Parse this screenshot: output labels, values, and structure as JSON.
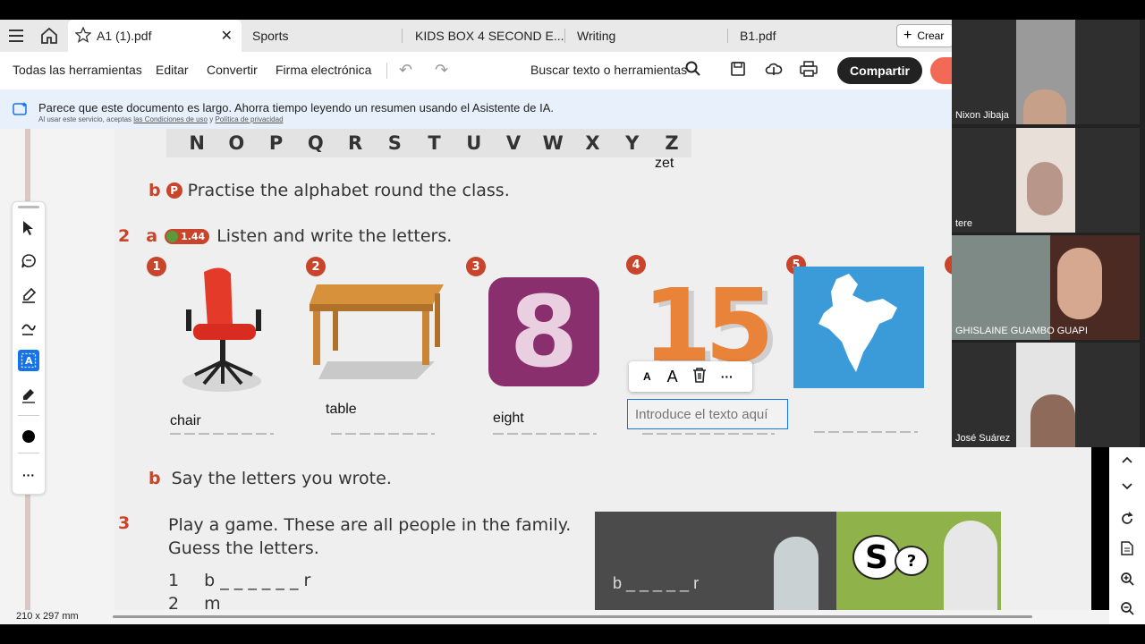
{
  "tabs": [
    {
      "label": "A1 (1).pdf",
      "active": true
    },
    {
      "label": "Sports"
    },
    {
      "label": "KIDS BOX 4 SECOND E..."
    },
    {
      "label": "Writing"
    },
    {
      "label": "B1.pdf"
    }
  ],
  "create_label": "Crear",
  "toolbar": {
    "all_tools": "Todas las herramientas",
    "edit": "Editar",
    "convert": "Convertir",
    "esign": "Firma electrónica",
    "search": "Buscar texto o herramientas",
    "share": "Compartir"
  },
  "banner": {
    "message": "Parece que este documento es largo. Ahorra tiempo leyendo un resumen usando el Asistente de IA.",
    "legal_prefix": "Al usar este servicio, aceptas",
    "terms_link": "las Condiciones de uso",
    "legal_join": "y",
    "privacy_link": "Política de privacidad"
  },
  "book": {
    "alphabet": [
      "N",
      "O",
      "P",
      "Q",
      "R",
      "S",
      "T",
      "U",
      "V",
      "W",
      "X",
      "Y",
      "Z"
    ],
    "zet_note": "zet",
    "ex1b_letter": "b",
    "ex1b_icon": "P",
    "ex1b_text": "Practise the alphabet round the class.",
    "ex2_num": "2",
    "ex2a_letter": "a",
    "ex2a_track": "1.44",
    "ex2a_text": "Listen and write the letters.",
    "items": [
      {
        "n": "1",
        "answer": "chair"
      },
      {
        "n": "2",
        "answer": "table"
      },
      {
        "n": "3",
        "answer": "eight"
      },
      {
        "n": "4",
        "answer": ""
      },
      {
        "n": "5",
        "answer": ""
      }
    ],
    "ex2b_letter": "b",
    "ex2b_text": "Say the letters you wrote.",
    "ex3_num": "3",
    "ex3_line1": "Play a game. These are all people in the family.",
    "ex3_line2": "Guess the letters.",
    "ex3_row1_n": "1",
    "ex3_row1": "b _ _ _ _ _ _ r",
    "ex3_row2_n": "2",
    "ex3_row2": "m",
    "eight_digit": "8",
    "fifteen": "15",
    "board_writing": "b _ _ _ _ _ r",
    "speech_s": "S",
    "speech_q": "?"
  },
  "text_input": {
    "placeholder": "Introduce el texto aquí"
  },
  "format_toolbar": {
    "small_a": "A",
    "big_a": "A",
    "more": "···"
  },
  "left_tools_more": "···",
  "participants": [
    {
      "name": "Nixon Jibaja"
    },
    {
      "name": "tere"
    },
    {
      "name": "GHISLAINE GUAMBO GUAPI"
    },
    {
      "name": "José Suárez"
    }
  ],
  "page_size": "210 x 297 mm",
  "colors": {
    "accent": "#1473e6",
    "banner": "#e8f1fb",
    "book_red": "#c8442a",
    "share_bg": "#222222"
  }
}
